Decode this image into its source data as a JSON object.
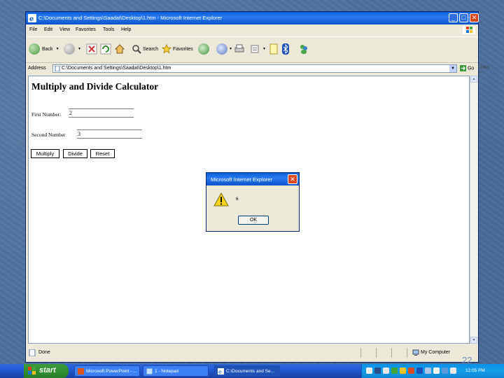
{
  "window": {
    "title": "C:\\Documents and Settings\\Saadat\\Desktop\\1.htm - Microsoft Internet Explorer",
    "controls": {
      "minimize": "_",
      "maximize": "□",
      "close": "✕"
    }
  },
  "menu": {
    "items": [
      "File",
      "Edit",
      "View",
      "Favorites",
      "Tools",
      "Help"
    ]
  },
  "toolbar": {
    "back_label": "Back",
    "search_label": "Search",
    "favorites_label": "Favorites"
  },
  "address": {
    "label": "Address",
    "value": "C:\\Documents and Settings\\Saadat\\Desktop\\1.htm",
    "go_label": "Go",
    "links_label": "Links"
  },
  "page": {
    "heading": "Multiply and Divide Calculator",
    "first_label": "First Number:",
    "first_value": "2",
    "second_label": "Second Number",
    "second_value": "3",
    "multiply_label": "Multiply",
    "divide_label": "Divide",
    "reset_label": "Reset"
  },
  "status": {
    "text": "Done",
    "zone": "My Computer"
  },
  "dialog": {
    "title": "Microsoft Internet Explorer",
    "message": "6",
    "ok_label": "OK",
    "icon": "warning-icon"
  },
  "taskbar": {
    "start_label": "start",
    "tasks": [
      "Microsoft PowerPoint - ...",
      "1 - Notepad",
      "C:\\Documents and Se..."
    ],
    "clock": "12:05 PM"
  },
  "slide_number": "22",
  "colors": {
    "xp_blue": "#0a5fd8",
    "start_green": "#2f8f2f",
    "desktop": "#4d6f9e"
  }
}
